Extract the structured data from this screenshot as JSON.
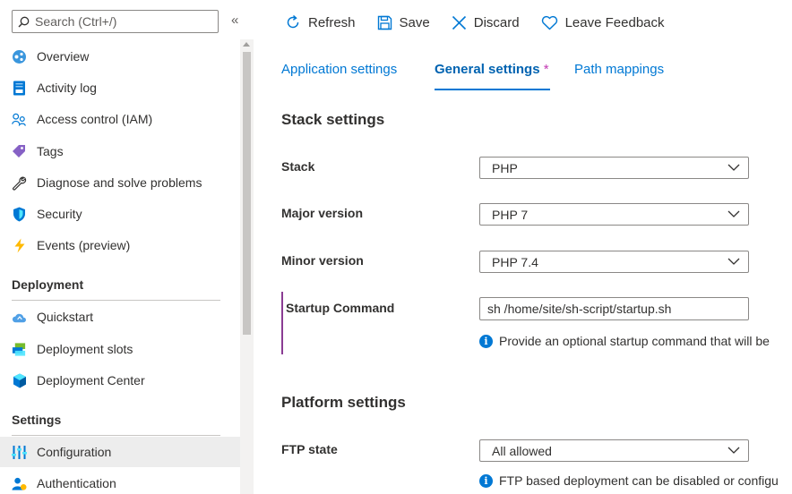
{
  "sidebar": {
    "search_placeholder": "Search (Ctrl+/)",
    "collapse_label": "«",
    "items": [
      {
        "label": "Overview",
        "icon": "overview-icon"
      },
      {
        "label": "Activity log",
        "icon": "activity-log-icon"
      },
      {
        "label": "Access control (IAM)",
        "icon": "access-control-icon"
      },
      {
        "label": "Tags",
        "icon": "tag-icon"
      },
      {
        "label": "Diagnose and solve problems",
        "icon": "wrench-icon"
      },
      {
        "label": "Security",
        "icon": "shield-icon"
      },
      {
        "label": "Events (preview)",
        "icon": "lightning-icon"
      }
    ],
    "sections": [
      {
        "title": "Deployment",
        "items": [
          {
            "label": "Quickstart",
            "icon": "cloud-icon"
          },
          {
            "label": "Deployment slots",
            "icon": "deployment-slots-icon"
          },
          {
            "label": "Deployment Center",
            "icon": "cube-icon"
          }
        ]
      },
      {
        "title": "Settings",
        "items": [
          {
            "label": "Configuration",
            "icon": "configuration-icon",
            "selected": true
          },
          {
            "label": "Authentication",
            "icon": "user-icon"
          }
        ]
      }
    ]
  },
  "toolbar": {
    "refresh_label": "Refresh",
    "save_label": "Save",
    "discard_label": "Discard",
    "feedback_label": "Leave Feedback"
  },
  "tabs": [
    {
      "label": "Application settings",
      "active": false
    },
    {
      "label": "General settings",
      "active": true,
      "marker": "*"
    },
    {
      "label": "Path mappings",
      "active": false
    }
  ],
  "stack_settings": {
    "title": "Stack settings",
    "stack": {
      "label": "Stack",
      "value": "PHP"
    },
    "major_version": {
      "label": "Major version",
      "value": "PHP 7"
    },
    "minor_version": {
      "label": "Minor version",
      "value": "PHP 7.4"
    },
    "startup_command": {
      "label": "Startup Command",
      "value": "sh /home/site/sh-script/startup.sh",
      "info": "Provide an optional startup command that will be"
    }
  },
  "platform_settings": {
    "title": "Platform settings",
    "ftp_state": {
      "label": "FTP state",
      "value": "All allowed",
      "info": "FTP based deployment can be disabled or configu"
    }
  },
  "colors": {
    "accent": "#0078d4",
    "modified_marker": "#c239b3",
    "selected_bg": "#ededed"
  }
}
